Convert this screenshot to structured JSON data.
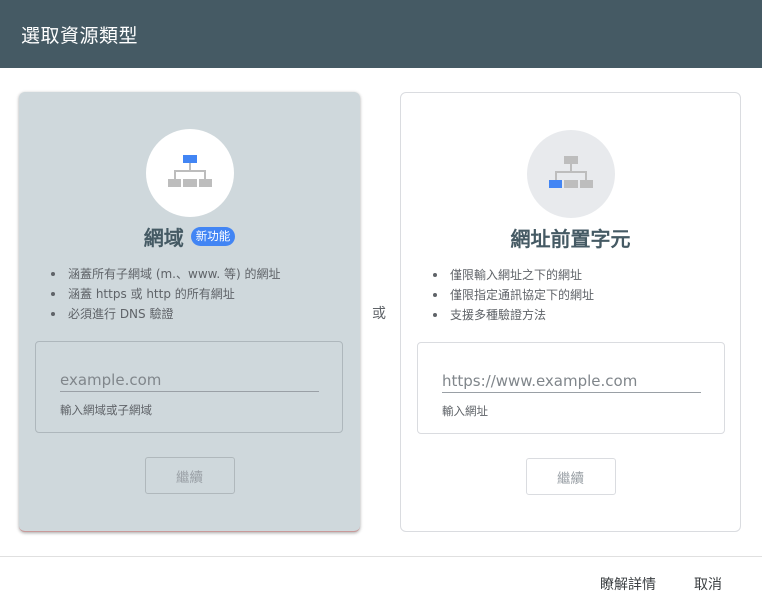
{
  "dialog": {
    "title": "選取資源類型"
  },
  "domain_card": {
    "title": "網域",
    "badge": "新功能",
    "bullets": [
      "涵蓋所有子網域 (m.、www. 等) 的網址",
      "涵蓋 https 或 http 的所有網址",
      "必須進行 DNS 驗證"
    ],
    "input_placeholder": "example.com",
    "input_hint": "輸入網域或子網域",
    "continue_label": "繼續"
  },
  "or_label": "或",
  "prefix_card": {
    "title": "網址前置字元",
    "bullets": [
      "僅限輸入網址之下的網址",
      "僅限指定通訊協定下的網址",
      "支援多種驗證方法"
    ],
    "input_placeholder": "https://www.example.com",
    "input_hint": "輸入網址",
    "continue_label": "繼續"
  },
  "footer": {
    "learn_more": "瞭解詳情",
    "cancel": "取消"
  },
  "colors": {
    "header": "#455a64",
    "selected_card": "#cfd8dc",
    "accent": "#4285f4",
    "icon_gray": "#bdbdbd"
  },
  "icons": {
    "domain": "sitemap-icon",
    "prefix": "sitemap-icon"
  }
}
